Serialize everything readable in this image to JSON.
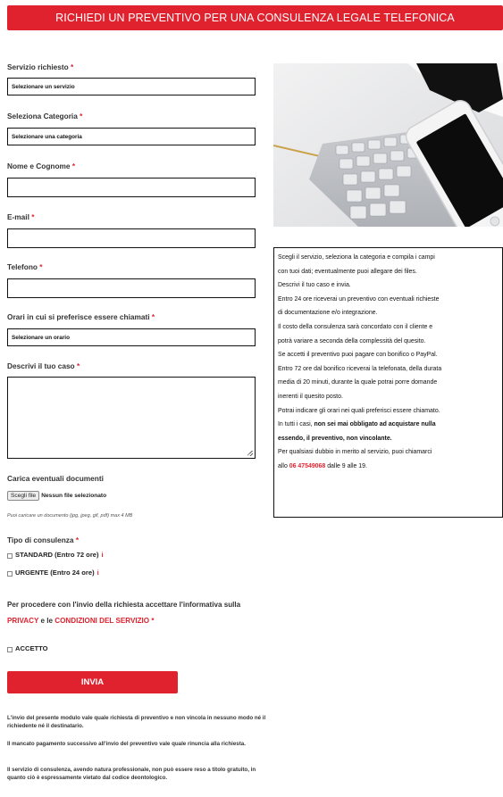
{
  "banner": {
    "title": "RICHIEDI UN PREVENTIVO PER UNA CONSULENZA LEGALE TELEFONICA"
  },
  "required_mark": "*",
  "form": {
    "servizio": {
      "label": "Servizio richiesto",
      "value": "Selezionare un servizio"
    },
    "categoria": {
      "label": "Seleziona Categoria",
      "value": "Selezionare una categoria"
    },
    "nome": {
      "label": "Nome e Cognome",
      "value": ""
    },
    "email": {
      "label": "E-mail",
      "value": ""
    },
    "telefono": {
      "label": "Telefono",
      "value": ""
    },
    "orari": {
      "label": "Orari in cui si preferisce essere chiamati",
      "value": "Selezionare un orario"
    },
    "descrizione": {
      "label": "Descrivi il tuo caso",
      "value": ""
    },
    "documenti": {
      "label": "Carica eventuali documenti",
      "button": "Scegli file",
      "status": "Nessun file selezionato",
      "hint": "Puoi caricare un documento (jpg, jpeg, gif, pdf) max 4 MB"
    },
    "tipo": {
      "label": "Tipo di consulenza",
      "options": [
        {
          "label": "STANDARD (Entro 72 ore)",
          "info": "i"
        },
        {
          "label": "URGENTE (Entro 24 ore)",
          "info": "i"
        }
      ]
    },
    "privacy": {
      "text1": "Per procedere con l'invio della richiesta accettare l'informativa sulla",
      "privacy_link": "PRIVACY",
      "text2": "e le",
      "conditions_link": "CONDIZIONI DEL SERVIZIO",
      "accept_label": "ACCETTO"
    },
    "submit": "INVIA",
    "notes": [
      "L'invio del presente modulo vale quale richiesta di preventivo e non vincola in nessuno modo né il richiedente né il destinatario.",
      "Il mancato pagamento successivo all'invio del preventivo vale quale rinuncia alla richiesta.",
      "Il servizio di consulenza, avendo natura professionale, non può essere reso a titolo gratuito, in quanto ciò è espressamente vietato dal codice deontologico."
    ]
  },
  "info": {
    "lines": [
      "Scegli il servizio, seleziona la categoria e compila i campi",
      "con tuoi dati; eventualmente puoi allegare dei files.",
      "Descrivi il tuo caso e invia.",
      "Entro 24 ore riceverai un preventivo con eventuali richieste",
      "di documentazione e/o integrazione.",
      "Il costo della consulenza sarà concordato con il cliente e",
      "potrà variare a seconda della complessità del quesito.",
      "Se accetti il preventivo puoi pagare con bonifico o PayPal.",
      "Entro 72 ore dal bonifico riceverai la telefonata, della durata",
      "media di 20 minuti, durante la quale potrai porre domande",
      "inerenti il quesito posto.",
      "Potrai indicare gli orari nei quali preferisci essere chiamato."
    ],
    "bold_intro": "In tutti i casi,",
    "bold_text": "non sei mai obbligato ad acquistare nulla",
    "bold_text2": "essendo, il preventivo, non vincolante.",
    "contact_text": "Per qualsiasi dubbio in merito al servizio, puoi chiamarci",
    "contact_prefix": "allo",
    "phone": "06 47549068",
    "contact_suffix": "dalle 9 alle 19."
  },
  "colors": {
    "accent": "#e0222f"
  }
}
